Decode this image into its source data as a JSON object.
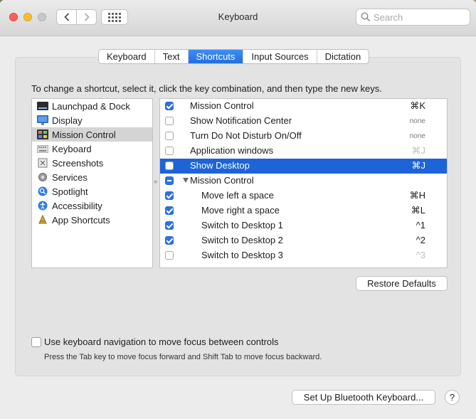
{
  "window": {
    "title": "Keyboard"
  },
  "search": {
    "placeholder": "Search"
  },
  "tabs": [
    "Keyboard",
    "Text",
    "Shortcuts",
    "Input Sources",
    "Dictation"
  ],
  "active_tab": "Shortcuts",
  "instructions": "To change a shortcut, select it, click the key combination, and then type the new keys.",
  "categories": [
    {
      "label": "Launchpad & Dock",
      "icon": "launchpad-dock-icon"
    },
    {
      "label": "Display",
      "icon": "display-icon"
    },
    {
      "label": "Mission Control",
      "icon": "mission-control-icon",
      "selected": true
    },
    {
      "label": "Keyboard",
      "icon": "keyboard-icon"
    },
    {
      "label": "Screenshots",
      "icon": "screenshots-icon"
    },
    {
      "label": "Services",
      "icon": "services-gear-icon"
    },
    {
      "label": "Spotlight",
      "icon": "spotlight-icon"
    },
    {
      "label": "Accessibility",
      "icon": "accessibility-icon"
    },
    {
      "label": "App Shortcuts",
      "icon": "app-shortcuts-icon"
    }
  ],
  "shortcuts": [
    {
      "label": "Mission Control",
      "key": "⌘K",
      "checked": true
    },
    {
      "label": "Show Notification Center",
      "key": "none",
      "checked": false
    },
    {
      "label": "Turn Do Not Disturb On/Off",
      "key": "none",
      "checked": false
    },
    {
      "label": "Application windows",
      "key": "⌘J",
      "checked": false,
      "dim": true
    },
    {
      "label": "Show Desktop",
      "key": "⌘J",
      "checked": false,
      "selected": true
    },
    {
      "label": "Mission Control",
      "key": "",
      "mixed": true,
      "group": true
    },
    {
      "label": "Move left a space",
      "key": "⌘H",
      "checked": true,
      "indent": true
    },
    {
      "label": "Move right a space",
      "key": "⌘L",
      "checked": true,
      "indent": true
    },
    {
      "label": "Switch to Desktop 1",
      "key": "^1",
      "checked": true,
      "indent": true
    },
    {
      "label": "Switch to Desktop 2",
      "key": "^2",
      "checked": true,
      "indent": true
    },
    {
      "label": "Switch to Desktop 3",
      "key": "^3",
      "checked": false,
      "indent": true,
      "dim": true
    }
  ],
  "buttons": {
    "restore": "Restore Defaults",
    "bluetooth": "Set Up Bluetooth Keyboard...",
    "help": "?"
  },
  "keyboard_nav": {
    "label": "Use keyboard navigation to move focus between controls",
    "hint": "Press the Tab key to move focus forward and Shift Tab to move focus backward.",
    "checked": false
  }
}
